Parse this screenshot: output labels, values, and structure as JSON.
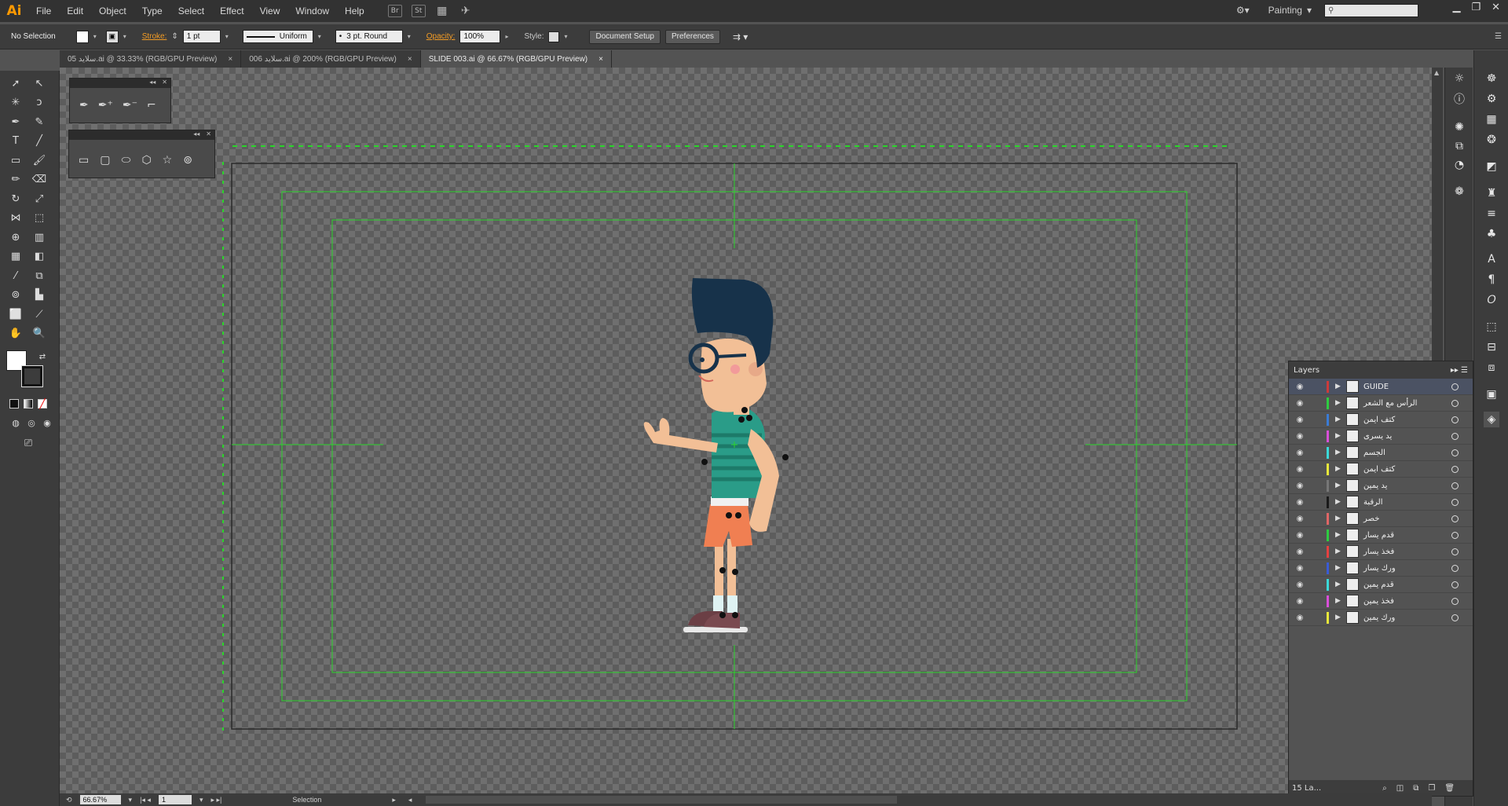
{
  "app": {
    "logo": "Ai"
  },
  "menu": [
    "File",
    "Edit",
    "Object",
    "Type",
    "Select",
    "Effect",
    "View",
    "Window",
    "Help"
  ],
  "menu_icons": {
    "bridge": "Br",
    "stock": "St"
  },
  "workspace": {
    "label": "Painting"
  },
  "control": {
    "selection": "No Selection",
    "stroke_label": "Stroke:",
    "stroke_weight": "1 pt",
    "profile": "Uniform",
    "brush": "3 pt. Round",
    "opacity_label": "Opacity:",
    "opacity": "100%",
    "style_label": "Style:",
    "doc_setup": "Document Setup",
    "preferences": "Preferences"
  },
  "tabs": [
    {
      "label": "05 سلايد.ai @ 33.33% (RGB/GPU Preview)",
      "close": "×"
    },
    {
      "label": "006 سلايد.ai @ 200% (RGB/GPU Preview)",
      "close": "×"
    },
    {
      "label": "SLIDE 003.ai @ 66.67% (RGB/GPU Preview)",
      "close": "×"
    }
  ],
  "layers": {
    "title": "Layers",
    "count": "15 La...",
    "items": [
      {
        "name": "GUIDE",
        "color": "#cc3a3a",
        "selected": true
      },
      {
        "name": "الرأس مع الشعر",
        "color": "#2ecc40"
      },
      {
        "name": "كتف ايمن",
        "color": "#3a7bd5"
      },
      {
        "name": "يد يسرى",
        "color": "#d94fd9"
      },
      {
        "name": "الجسم",
        "color": "#3ad9d9"
      },
      {
        "name": "كتف ايمن",
        "color": "#e8e83a"
      },
      {
        "name": "يد يمين",
        "color": "#777777"
      },
      {
        "name": "الرقبة",
        "color": "#1a1a1a"
      },
      {
        "name": "خصر",
        "color": "#e06666"
      },
      {
        "name": "قدم يسار",
        "color": "#2ecc40"
      },
      {
        "name": "فخذ يسار",
        "color": "#e64040"
      },
      {
        "name": "ورك يسار",
        "color": "#3a5bd5"
      },
      {
        "name": "قدم يمين",
        "color": "#3ad9d9"
      },
      {
        "name": "فخذ يمين",
        "color": "#d94fd9"
      },
      {
        "name": "ورك يمين",
        "color": "#e8e83a"
      }
    ]
  },
  "status": {
    "zoom": "66.67%",
    "artboard": "1",
    "tool": "Selection"
  },
  "colors": {
    "accent": "#ff9a00",
    "guide": "#2bd42b",
    "hair": "#17324a",
    "shirt": "#2a9c88",
    "skin": "#f2bf96",
    "shorts": "#f07f52"
  }
}
